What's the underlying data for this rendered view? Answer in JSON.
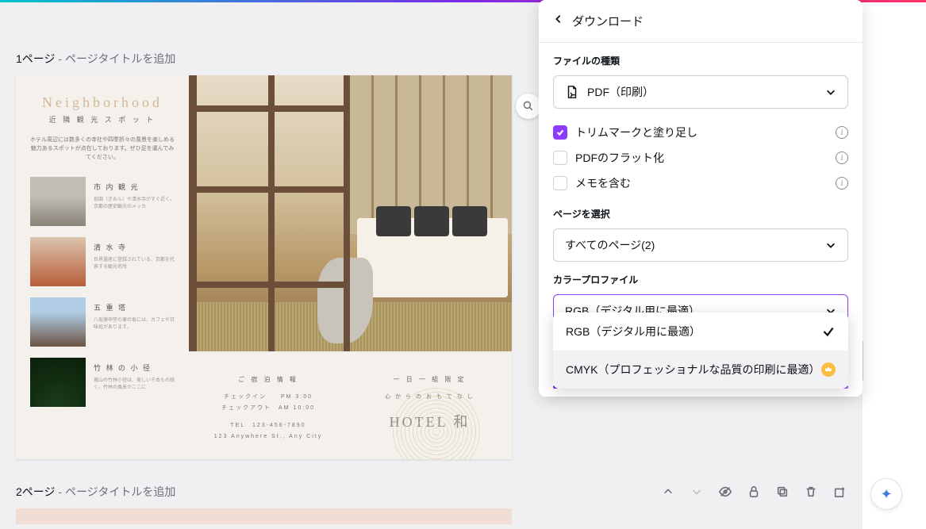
{
  "pages": {
    "page1": {
      "label": "1ページ",
      "addTitle": " - ページタイトルを追加"
    },
    "page2": {
      "label": "2ページ",
      "addTitle": " - ページタイトルを追加"
    }
  },
  "design": {
    "neighborhood": {
      "title": "Neighborhood",
      "subtitle": "近 隣 観 光 ス ポ ッ ト",
      "desc": "ホテル周辺には数多くの寺社や四季折々の風景を楽しめる魅力あるスポットが点在しております。ぜひ足を運んでみてください。"
    },
    "spots": [
      {
        "name": "市 内 観 光",
        "desc": "祇園（ぎおん）や清水寺がすぐ近く。京都の歴史観光のメッカ"
      },
      {
        "name": "清 水 寺",
        "desc": "世界遺産に登録されている、京都を代表する観光名所"
      },
      {
        "name": "五 重 塔",
        "desc": "八坂庚申堂の東の坂には、カフェや甘味処があります。"
      },
      {
        "name": "竹 林 の 小 径",
        "desc": "嵐山の竹林小径は、美しい千本もの続く、竹林の風景がここに"
      }
    ],
    "info": {
      "title": "ご 宿 泊 情 報",
      "lines": "チェックイン　　PM 3:00\nチェックアウト　AM 10:00",
      "tel": "TEL　123-456-7890",
      "addr": "123 Anywhere St., Any City"
    },
    "hotel": {
      "line1": "一 日 一 組 限 定",
      "line2": "心 か ら の お も て な し",
      "name": "HOTEL 和"
    }
  },
  "download": {
    "title": "ダウンロード",
    "fileType": {
      "label": "ファイルの種類",
      "value": "PDF（印刷）"
    },
    "checkboxes": {
      "trim": "トリムマークと塗り足し",
      "flatten": "PDFのフラット化",
      "memo": "メモを含む"
    },
    "pageSelect": {
      "label": "ページを選択",
      "value": "すべてのページ(2)"
    },
    "colorProfile": {
      "label": "カラープロファイル",
      "value": "RGB（デジタル用に最適）",
      "options": {
        "rgb": "RGB（デジタル用に最適）",
        "cmyk": "CMYK（プロフェッショナルな品質の印刷に最適）"
      }
    }
  }
}
